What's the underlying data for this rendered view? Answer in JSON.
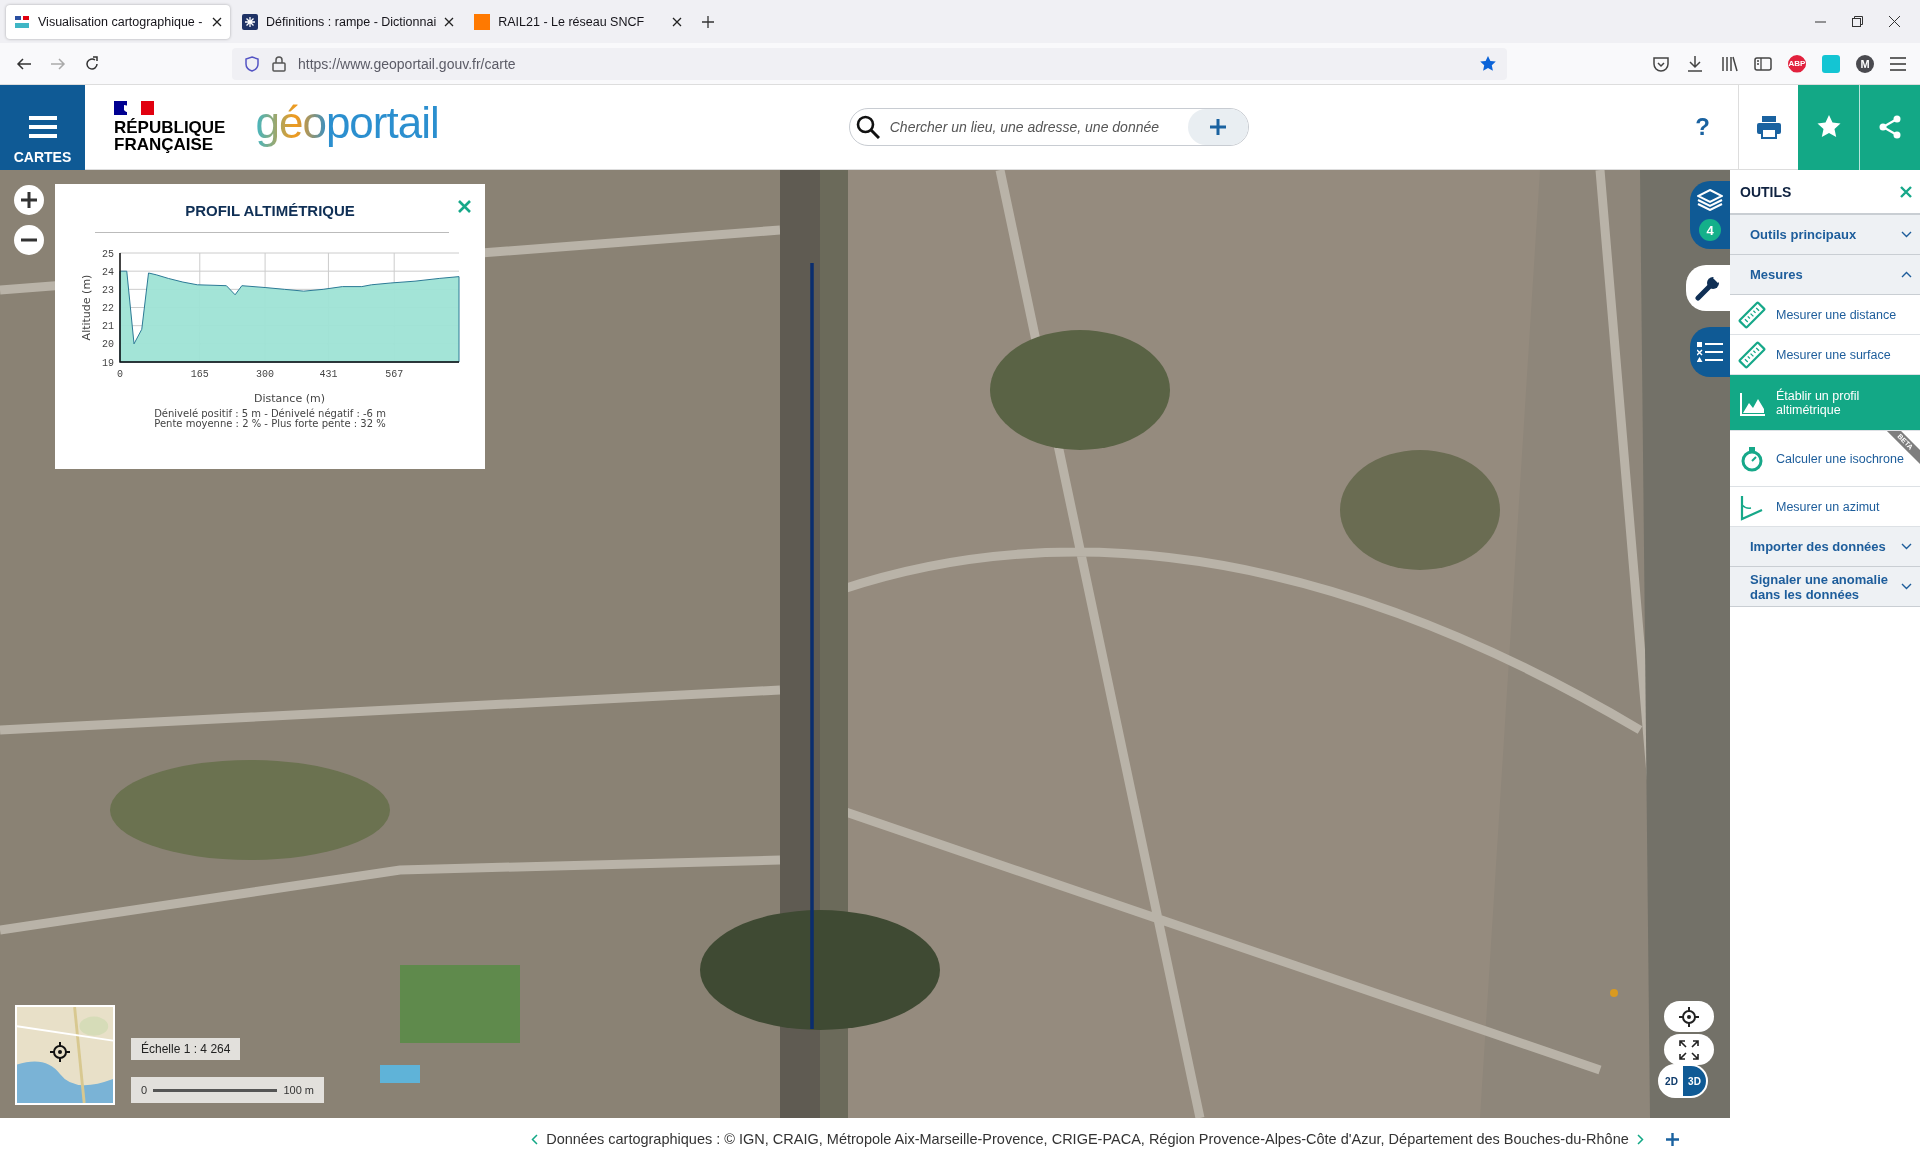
{
  "browser": {
    "tabs": [
      {
        "title": "Visualisation cartographique -",
        "kind": "geo",
        "selected": true
      },
      {
        "title": "Définitions : rampe - Dictionnai",
        "kind": "dict",
        "selected": false
      },
      {
        "title": "RAIL21 - Le réseau SNCF",
        "kind": "orange",
        "selected": false
      }
    ],
    "url": "https://www.geoportail.gouv.fr/carte",
    "extensions": [
      "ABP",
      "M"
    ]
  },
  "header": {
    "menu_label": "CARTES",
    "republic": "RÉPUBLIQUE\nFRANÇAISE",
    "logo": "géoportail",
    "search": {
      "placeholder": "Chercher un lieu, une adresse, une donnée"
    },
    "help": "?"
  },
  "profile_panel": {
    "title": "PROFIL ALTIMÉTRIQUE",
    "chart_data": {
      "type": "area",
      "xlabel": "Distance (m)",
      "ylabel": "Altitude (m)",
      "x": [
        0,
        14,
        29,
        45,
        59,
        75,
        100,
        130,
        160,
        220,
        238,
        252,
        300,
        340,
        380,
        420,
        460,
        500,
        520,
        560,
        610,
        660,
        701
      ],
      "series": [
        {
          "color": "#9ee3d5",
          "values": [
            24,
            24,
            20,
            20.8,
            23.9,
            23.8,
            23.6,
            23.4,
            23.25,
            23.2,
            22.7,
            23.2,
            23.1,
            23.0,
            22.9,
            23.0,
            23.15,
            23.15,
            23.25,
            23.35,
            23.45,
            23.6,
            23.7
          ]
        }
      ],
      "xlim": [
        0,
        701
      ],
      "ylim": [
        19,
        25
      ],
      "grid": true,
      "xticks": [
        0,
        165,
        300,
        431,
        567
      ],
      "yticks": [
        19,
        20,
        21,
        22,
        23,
        24,
        25
      ]
    },
    "summary": [
      "Dénivelé positif : 5 m - Dénivelé négatif : -6 m",
      "Pente moyenne : 2 % - Plus forte pente : 32 %"
    ]
  },
  "side_tabs": [
    {
      "kind": "layers",
      "badge": "4",
      "selected": false
    },
    {
      "kind": "tools",
      "selected": true
    },
    {
      "kind": "legend",
      "selected": false
    }
  ],
  "tools_panel": {
    "title": "OUTILS",
    "sections": [
      {
        "label": "Outils principaux",
        "expanded": false
      },
      {
        "label": "Mesures",
        "expanded": true,
        "items": [
          {
            "label": "Mesurer une distance",
            "kind": "ruler",
            "selected": false
          },
          {
            "label": "Mesurer une surface",
            "kind": "ruler",
            "selected": false
          },
          {
            "label": "Établir un profil altimétrique",
            "kind": "profile",
            "selected": true
          },
          {
            "label": "Calculer une isochrone",
            "kind": "isochrone",
            "selected": false,
            "badge": "BETA"
          },
          {
            "label": "Mesurer un azimut",
            "kind": "azimut",
            "selected": false
          }
        ]
      },
      {
        "label": "Importer des données",
        "expanded": false
      },
      {
        "label": "Signaler une anomalie dans les données",
        "expanded": false
      }
    ]
  },
  "scale": {
    "label": "Échelle 1 : 4 264",
    "start": "0",
    "end": "100 m"
  },
  "view_mode": [
    {
      "label": "2D",
      "selected": false
    },
    {
      "label": "3D",
      "selected": true
    }
  ],
  "footer": {
    "attribution": "Données cartographiques : © IGN, CRAIG, Métropole Aix-Marseille-Provence, CRIGE-PACA, Région Provence-Alpes-Côte d'Azur, Département des Bouches-du-Rhône"
  }
}
